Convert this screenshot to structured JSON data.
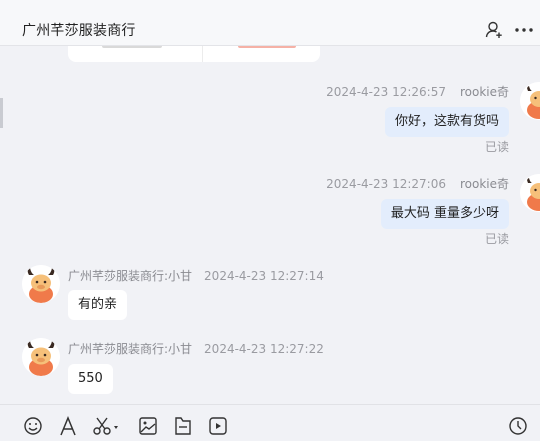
{
  "header": {
    "title": "广州芊莎服装商行",
    "icons": [
      "add-user-icon",
      "more-icon"
    ]
  },
  "messages": [
    {
      "direction": "outgoing",
      "timestamp": "2024-4-23 12:26:57",
      "sender": "rookie奇",
      "text": "你好，这款有货吗",
      "status": "已读"
    },
    {
      "direction": "outgoing",
      "timestamp": "2024-4-23 12:27:06",
      "sender": "rookie奇",
      "text": "最大码  重量多少呀",
      "status": "已读"
    },
    {
      "direction": "incoming",
      "sender": "广州芊莎服装商行:小甘",
      "timestamp": "2024-4-23 12:27:14",
      "text": "有的亲"
    },
    {
      "direction": "incoming",
      "sender": "广州芊莎服装商行:小甘",
      "timestamp": "2024-4-23 12:27:22",
      "text": "550"
    }
  ],
  "toolbar": {
    "icons": [
      "emoji-icon",
      "font-icon",
      "scissors-icon",
      "image-icon",
      "file-icon",
      "video-icon",
      "history-icon"
    ]
  },
  "colors": {
    "background": "#f1f2f6",
    "outgoing_bubble": "#e3edfc",
    "incoming_bubble": "#ffffff",
    "avatar_accent": "#f07a4a"
  }
}
